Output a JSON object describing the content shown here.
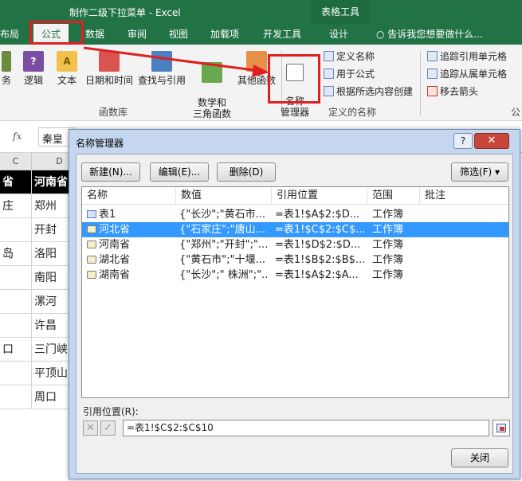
{
  "window": {
    "title": "制作二级下拉菜单 - Excel",
    "table_tools_tab": "表格工具"
  },
  "tabs": {
    "layout": "布局",
    "formulas": "公式",
    "data": "数据",
    "review": "审阅",
    "view": "视图",
    "addins": "加载项",
    "developer": "开发工具",
    "design": "设计",
    "tell_me": "告诉我您想要做什么..."
  },
  "ribbon": {
    "groups": {
      "function_library": "函数库",
      "defined_names": "定义的名称"
    },
    "buttons": {
      "financial": "务",
      "logical": "逻辑",
      "text": "文本",
      "datetime": "日期和时间",
      "lookup": "查找与引用",
      "math_trig": "数学和\n三角函数",
      "more_functions": "其他函数",
      "name_manager": "名称\n管理器",
      "define_name": "定义名称",
      "use_in_formula": "用于公式",
      "create_from_selection": "根据所选内容创建",
      "trace_precedents": "追踪引用单元格",
      "trace_dependents": "追踪从属单元格",
      "remove_arrows": "移去箭头",
      "cut_label": "公"
    },
    "colors": {
      "green": "#217346",
      "highlight_red": "#e02020"
    }
  },
  "formula_bar": {
    "fx": "fx",
    "value": "秦皇"
  },
  "sheet": {
    "columns": [
      "C",
      "D"
    ],
    "header_row": [
      "省",
      "河南省"
    ],
    "rows": [
      [
        "庄",
        "郑州"
      ],
      [
        "",
        "开封"
      ],
      [
        "岛",
        "洛阳"
      ],
      [
        "",
        "南阳"
      ],
      [
        "",
        "漯河"
      ],
      [
        "",
        "许昌"
      ],
      [
        "口",
        "三门峡"
      ],
      [
        "",
        "平顶山"
      ],
      [
        "",
        "周口"
      ]
    ]
  },
  "dialog": {
    "title": "名称管理器",
    "help": "?",
    "close": "✕",
    "buttons": {
      "new": "新建(N)...",
      "edit": "编辑(E)...",
      "delete": "删除(D)",
      "filter": "筛选(F) ▾",
      "close": "关闭"
    },
    "columns": [
      "名称",
      "数值",
      "引用位置",
      "范围",
      "批注"
    ],
    "rows": [
      {
        "name": "表1",
        "value": "{\"长沙\";\"黄石市...",
        "ref": "=表1!$A$2:$D...",
        "scope": "工作簿",
        "comment": "",
        "type": "table"
      },
      {
        "name": "河北省",
        "value": "{\"石家庄\";\"唐山...",
        "ref": "=表1!$C$2:$C$...",
        "scope": "工作簿",
        "comment": "",
        "type": "name",
        "selected": true
      },
      {
        "name": "河南省",
        "value": "{\"郑州\";\"开封\";\"...",
        "ref": "=表1!$D$2:$D...",
        "scope": "工作簿",
        "comment": "",
        "type": "name"
      },
      {
        "name": "湖北省",
        "value": "{\"黄石市\";\"十堰...",
        "ref": "=表1!$B$2:$B$...",
        "scope": "工作簿",
        "comment": "",
        "type": "name"
      },
      {
        "name": "湖南省",
        "value": "{\"长沙\";\" 株洲\";\"...",
        "ref": "=表1!$A$2:$A...",
        "scope": "工作簿",
        "comment": "",
        "type": "name"
      }
    ],
    "ref_label": "引用位置(R):",
    "ref_value": "=表1!$C$2:$C$10",
    "cancel_icon": "✕",
    "confirm_icon": "✓"
  }
}
